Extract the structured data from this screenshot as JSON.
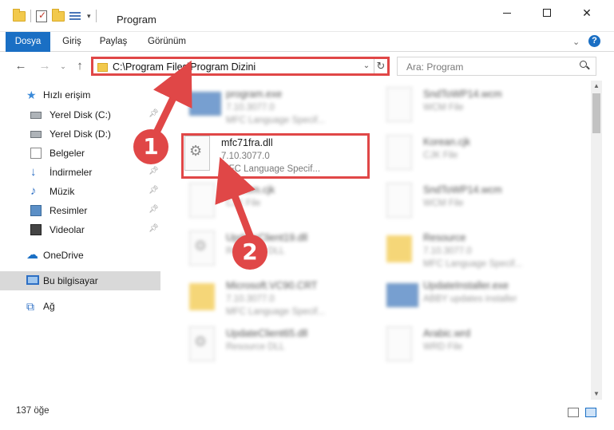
{
  "window": {
    "title": "Program",
    "minimize_label": "",
    "maximize_label": "",
    "close_label": "✕"
  },
  "ribbon": {
    "tabs": [
      {
        "label": "Dosya"
      },
      {
        "label": "Giriş"
      },
      {
        "label": "Paylaş"
      },
      {
        "label": "Görünüm"
      }
    ],
    "help": "?"
  },
  "nav": {
    "address": "C:\\Program Files\\Program Dizini",
    "search_placeholder": "Ara: Program"
  },
  "sidebar": {
    "items": [
      {
        "label": "Hızlı erişim",
        "icon": "star-icon"
      },
      {
        "label": "Yerel Disk (C:)",
        "icon": "disk-icon",
        "pinned": true
      },
      {
        "label": "Yerel Disk (D:)",
        "icon": "disk-icon"
      },
      {
        "label": "Belgeler",
        "icon": "documents-icon",
        "pinned": true
      },
      {
        "label": "İndirmeler",
        "icon": "download-icon",
        "pinned": true
      },
      {
        "label": "Müzik",
        "icon": "music-icon",
        "pinned": true
      },
      {
        "label": "Resimler",
        "icon": "pictures-icon",
        "pinned": true
      },
      {
        "label": "Videolar",
        "icon": "video-icon",
        "pinned": true
      },
      {
        "label": "OneDrive",
        "icon": "cloud-icon"
      },
      {
        "label": "Bu bilgisayar",
        "icon": "computer-icon",
        "selected": true
      },
      {
        "label": "Ağ",
        "icon": "network-icon"
      }
    ]
  },
  "files": [
    {
      "name": "program.exe",
      "line1": "7.10.3077.0",
      "line2": "MFC Language Specif...",
      "icon": "app-icon",
      "blurred": true
    },
    {
      "name": "SndToWP14.wcm",
      "line1": "WCM File",
      "line2": "",
      "icon": "file-icon",
      "blurred": true
    },
    {
      "name": "mfc71fra.dll",
      "line1": "7.10.3077.0",
      "line2": "MFC Language Specif...",
      "icon": "gear-file-icon",
      "blurred": false
    },
    {
      "name": "Korean.cjk",
      "line1": "CJK File",
      "line2": "",
      "icon": "file-icon",
      "blurred": true
    },
    {
      "name": "Eptcom.cjk",
      "line1": "CJK File",
      "line2": "",
      "icon": "file-icon",
      "blurred": true
    },
    {
      "name": "SndToWP14.wcm",
      "line1": "WCM File",
      "line2": "",
      "icon": "file-icon",
      "blurred": true
    },
    {
      "name": "UpdateClient19.dll",
      "line1": "Resource DLL",
      "line2": "",
      "icon": "gear-file-icon",
      "blurred": true
    },
    {
      "name": "Resource",
      "line1": "7.10.3077.0",
      "line2": "MFC Language Specif...",
      "icon": "folder-icon",
      "blurred": true
    },
    {
      "name": "Microsoft.VC90.CRT",
      "line1": "7.10.3077.0",
      "line2": "MFC Language Specif...",
      "icon": "folder-icon",
      "blurred": true
    },
    {
      "name": "UpdateInstaller.exe",
      "line1": "ABBY updates installer",
      "line2": "",
      "icon": "app-icon",
      "blurred": true
    },
    {
      "name": "UpdateClient65.dll",
      "line1": "Resource DLL",
      "line2": "",
      "icon": "gear-file-icon",
      "blurred": true
    },
    {
      "name": "Arabic.wrd",
      "line1": "WRD File",
      "line2": "",
      "icon": "file-icon",
      "blurred": true
    }
  ],
  "status": {
    "count": "137 öğe"
  },
  "annotations": {
    "step1": "1",
    "step2": "2",
    "color": "#e04747"
  },
  "colors": {
    "accent": "#1a6fc4",
    "highlight": "#e04747",
    "selected_bg": "#d9d9d9"
  }
}
